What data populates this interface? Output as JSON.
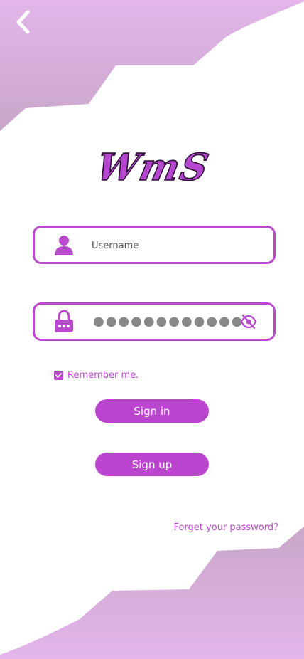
{
  "colors": {
    "accent": "#b94acd",
    "button": "#bb45cf",
    "bg_gradient_light": "#e0b5e8",
    "bg_gradient_dark": "#c9a6c9"
  },
  "logo": {
    "text": "WmS"
  },
  "username": {
    "placeholder": "Username",
    "icon": "user-icon"
  },
  "password": {
    "masked_value": "●●●●●●●●●●●●",
    "icon": "lock-icon",
    "toggle_icon": "eye-off-icon"
  },
  "remember": {
    "label": "Remember me.",
    "checked": true
  },
  "buttons": {
    "signin_label": "Sign in",
    "signup_label": "Sign up"
  },
  "links": {
    "forgot_label": "Forget your password?"
  },
  "nav": {
    "back_icon": "chevron-left-icon"
  }
}
